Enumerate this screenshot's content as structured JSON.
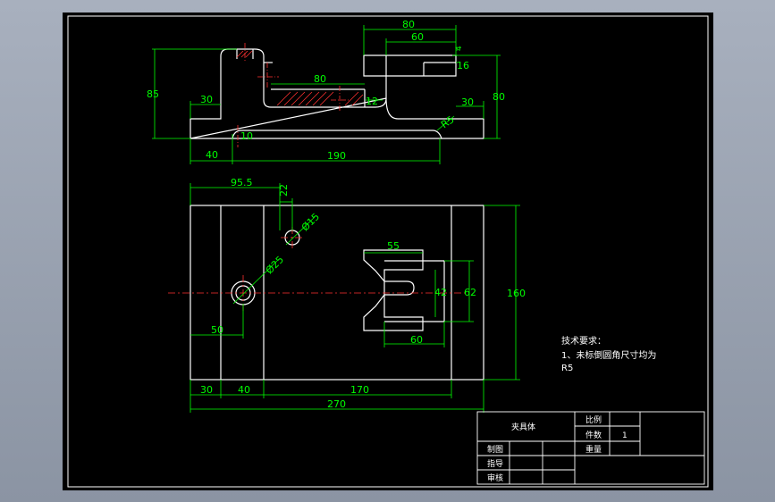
{
  "top_view": {
    "dims": [
      "80",
      "60",
      "4",
      "16",
      "80",
      "85",
      "30",
      "80",
      "12",
      "30",
      "R5",
      "10",
      "40",
      "190"
    ]
  },
  "plan_view": {
    "dims": [
      "95.5",
      "22",
      "Ø15",
      "Ø25",
      "55",
      "42",
      "62",
      "160",
      "50",
      "60",
      "30",
      "40",
      "170",
      "270"
    ]
  },
  "notes": {
    "line1": "技术要求：",
    "line2": "1、未标倒圆角尺寸均为",
    "line3": "R5"
  },
  "title_block": {
    "part_name": "夹具体",
    "scale_label": "比例",
    "pieces_label": "件数",
    "pieces_value": "1",
    "weight_label": "重量",
    "drawn_label": "制图",
    "guide_label": "指导",
    "review_label": "审核"
  },
  "colors": {
    "background": "#000000",
    "outline": "#ffffff",
    "dimension": "#00ff00",
    "centerline": "#ff0000",
    "hatch": "#ff3030",
    "window": "#9aa3b1"
  }
}
